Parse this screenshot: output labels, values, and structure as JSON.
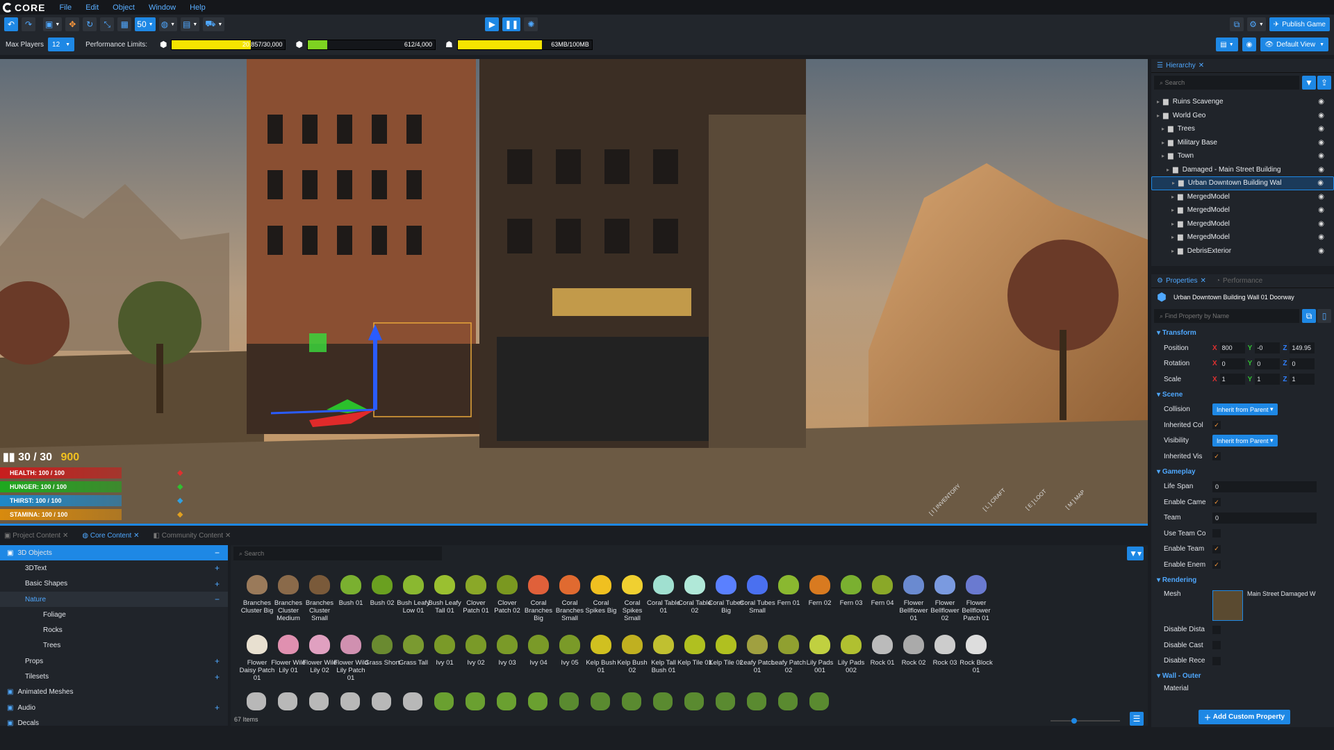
{
  "app": {
    "logo_text": "CORE"
  },
  "menu": [
    "File",
    "Edit",
    "Object",
    "Window",
    "Help"
  ],
  "toolbar": {
    "snap_value": "50",
    "publish_label": "Publish Game",
    "default_view_label": "Default View"
  },
  "perf": {
    "max_players_label": "Max Players",
    "max_players_value": "12",
    "limits_label": "Performance Limits:",
    "bars": [
      {
        "text": "20,857/30,000",
        "fraction": 0.695,
        "color": "#f5e400"
      },
      {
        "text": "612/4,000",
        "fraction": 0.153,
        "color": "#7ed321"
      },
      {
        "text": "63MB/100MB",
        "fraction": 0.63,
        "color": "#f5e400"
      }
    ]
  },
  "hud": {
    "ammo": "30 / 30",
    "gold": "900",
    "stats": [
      {
        "label": "HEALTH: 100 / 100",
        "color": "#c81e1e"
      },
      {
        "label": "HUNGER: 100 / 100",
        "color": "#1fa81f"
      },
      {
        "label": "THIRST: 100 / 100",
        "color": "#1e88c8"
      },
      {
        "label": "STAMINA: 100 / 100",
        "color": "#d88a0e"
      }
    ],
    "actions": [
      "[ I ] INVENTORY",
      "[ L ] CRAFT",
      "[ E ] LOOT",
      "[ M ] MAP"
    ]
  },
  "hierarchy": {
    "tab": "Hierarchy",
    "search_placeholder": "Search",
    "rows": [
      {
        "label": "Ruins Scavenge",
        "indent": 0
      },
      {
        "label": "World Geo",
        "indent": 0
      },
      {
        "label": "Trees",
        "indent": 1
      },
      {
        "label": "Military Base",
        "indent": 1
      },
      {
        "label": "Town",
        "indent": 1
      },
      {
        "label": "Damaged - Main Street Building",
        "indent": 2
      },
      {
        "label": "Urban Downtown Building Wal",
        "indent": 3,
        "selected": true
      },
      {
        "label": "MergedModel",
        "indent": 3
      },
      {
        "label": "MergedModel",
        "indent": 3
      },
      {
        "label": "MergedModel",
        "indent": 3
      },
      {
        "label": "MergedModel",
        "indent": 3
      },
      {
        "label": "DebrisExterior",
        "indent": 3
      }
    ]
  },
  "properties": {
    "tab": "Properties",
    "tab2": "Performance",
    "object_name": "Urban Downtown Building Wall 01 Doorway",
    "search_placeholder": "Find Property by Name",
    "transform_label": "Transform",
    "position": {
      "label": "Position",
      "x": "800",
      "y": "-0",
      "z": "149.95"
    },
    "rotation": {
      "label": "Rotation",
      "x": "0",
      "y": "0",
      "z": "0"
    },
    "scale": {
      "label": "Scale",
      "x": "1",
      "y": "1",
      "z": "1"
    },
    "scene_label": "Scene",
    "collision": "Collision",
    "collision_val": "Inherit from Parent",
    "inherited_col": "Inherited Col",
    "visibility": "Visibility",
    "visibility_val": "Inherit from Parent",
    "inherited_vis": "Inherited Vis",
    "gameplay_label": "Gameplay",
    "life_span": "Life Span",
    "life_span_val": "0",
    "enable_came": "Enable Came",
    "team": "Team",
    "team_val": "0",
    "use_team": "Use Team Co",
    "enable_team": "Enable Team",
    "enable_enem": "Enable Enem",
    "rendering_label": "Rendering",
    "mesh": "Mesh",
    "mesh_name": "Main Street Damaged W",
    "disable_dista": "Disable Dista",
    "disable_cast": "Disable Cast",
    "disable_rece": "Disable Rece",
    "wall_label": "Wall - Outer",
    "material": "Material",
    "add_prop": "Add Custom Property"
  },
  "content": {
    "tabs": [
      "Project Content",
      "Core Content",
      "Community Content"
    ],
    "search_placeholder": "Search",
    "count": "67 Items",
    "tree": [
      {
        "label": "3D Objects",
        "level": 0,
        "sel": true,
        "sign": "−"
      },
      {
        "label": "3DText",
        "level": 1,
        "sign": "+"
      },
      {
        "label": "Basic Shapes",
        "level": 1,
        "sign": "+"
      },
      {
        "label": "Nature",
        "level": 1,
        "active": true,
        "sign": "−"
      },
      {
        "label": "Foliage",
        "level": 2
      },
      {
        "label": "Rocks",
        "level": 2
      },
      {
        "label": "Trees",
        "level": 2
      },
      {
        "label": "Props",
        "level": 1,
        "sign": "+"
      },
      {
        "label": "Tilesets",
        "level": 1,
        "sign": "+"
      },
      {
        "label": "Animated Meshes",
        "level": 0
      },
      {
        "label": "Audio",
        "level": 0,
        "sign": "+"
      },
      {
        "label": "Decals",
        "level": 0
      }
    ],
    "items": [
      "Branches Cluster Big",
      "Branches Cluster Medium",
      "Branches Cluster Small",
      "Bush 01",
      "Bush 02",
      "Bush Leafy Low 01",
      "Bush Leafy Tall 01",
      "Clover Patch 01",
      "Clover Patch 02",
      "Coral Branches Big",
      "Coral Branches Small",
      "Coral Spikes Big",
      "Coral Spikes Small",
      "Coral Table 01",
      "Coral Table 02",
      "Coral Tubes Big",
      "Coral Tubes Small",
      "Fern 01",
      "Fern 02",
      "Fern 03",
      "Fern 04",
      "Flower Bellflower 01",
      "Flower Bellflower 02",
      "Flower Bellflower Patch 01",
      "Flower Daisy Patch 01",
      "Flower Wild Lily 01",
      "Flower Wild Lily 02",
      "Flower Wild Lily Patch 01",
      "Grass Short",
      "Grass Tall",
      "Ivy 01",
      "Ivy 02",
      "Ivy 03",
      "Ivy 04",
      "Ivy 05",
      "Kelp Bush 01",
      "Kelp Bush 02",
      "Kelp Tall Bush 01",
      "Kelp Tile 01",
      "Kelp Tile 02",
      "Leafy Patch 01",
      "Leafy Patch 02",
      "Lily Pads 001",
      "Lily Pads 002",
      "Rock 01",
      "Rock 02",
      "Rock 03",
      "Rock Block 01"
    ]
  }
}
